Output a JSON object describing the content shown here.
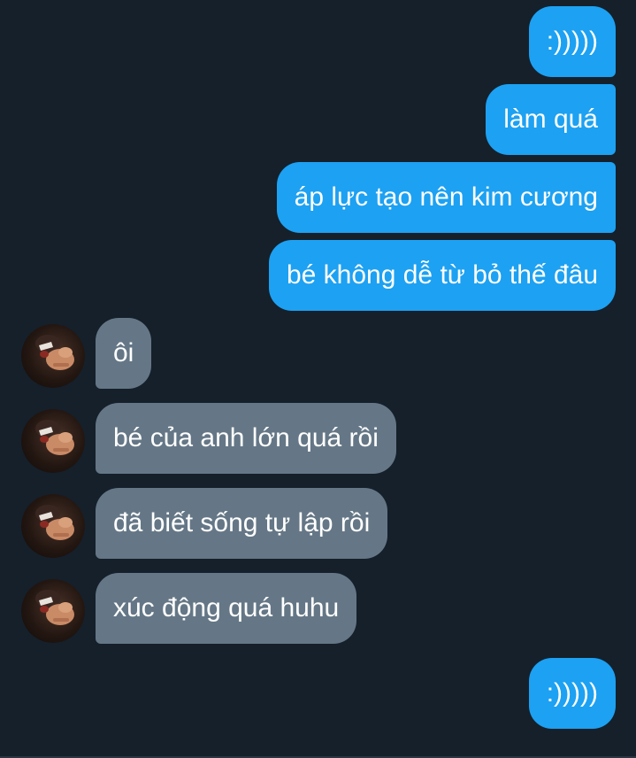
{
  "messages": [
    {
      "sender": "self",
      "text": ":)))))"
    },
    {
      "sender": "self",
      "text": "làm quá"
    },
    {
      "sender": "self",
      "text": "áp lực tạo nên kim cương"
    },
    {
      "sender": "self",
      "text": "bé không dễ từ bỏ thế đâu"
    },
    {
      "sender": "other",
      "text": "ôi"
    },
    {
      "sender": "other",
      "text": "bé của anh lớn quá rồi"
    },
    {
      "sender": "other",
      "text": "đã biết sống tự lập rồi"
    },
    {
      "sender": "other",
      "text": "xúc động quá huhu"
    },
    {
      "sender": "self",
      "text": ":)))))"
    }
  ],
  "colors": {
    "background": "#15202b",
    "sent_bubble": "#1da1f2",
    "received_bubble": "#657786",
    "text": "#ffffff"
  },
  "icons": {
    "avatar": "contact-avatar-photo"
  }
}
